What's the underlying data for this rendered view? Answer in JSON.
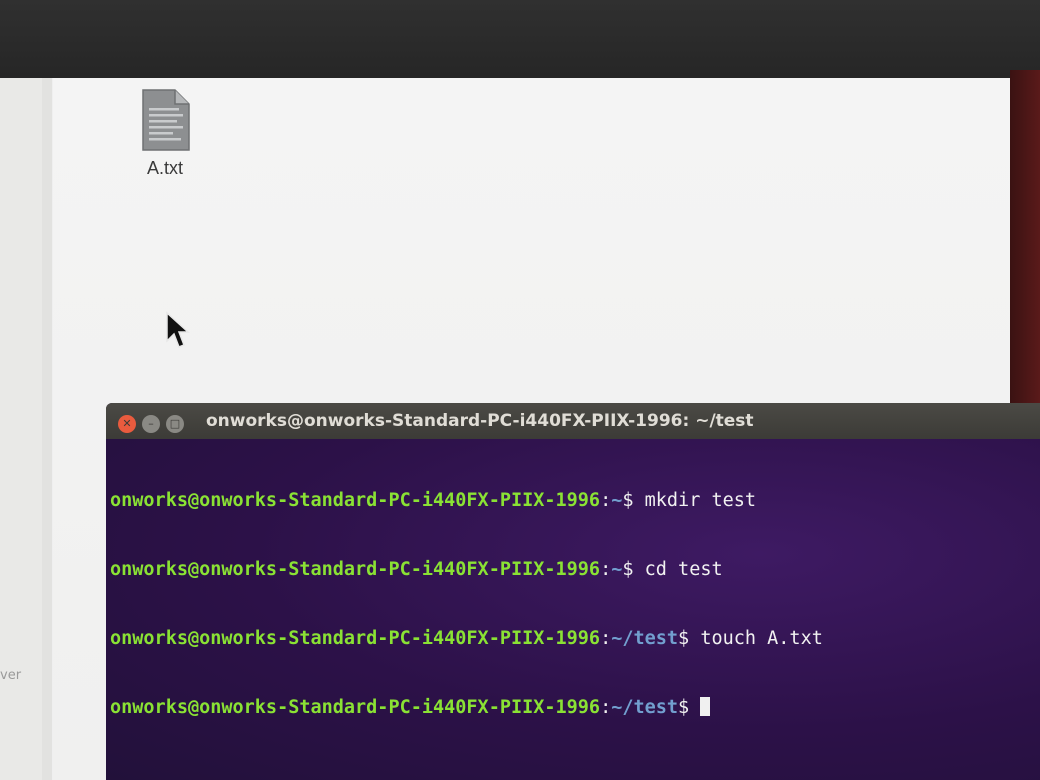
{
  "file_manager": {
    "files": [
      {
        "name": "A.txt",
        "icon": "text-file-icon"
      }
    ],
    "sidebar_partial_text": "ver"
  },
  "terminal": {
    "title": "onworks@onworks-Standard-PC-i440FX-PIIX-1996: ~/test",
    "lines": [
      {
        "user": "onworks@onworks-Standard-PC-i440FX-PIIX-1996",
        "sep": ":",
        "path": "~",
        "suffix": "$ ",
        "command": "mkdir test"
      },
      {
        "user": "onworks@onworks-Standard-PC-i440FX-PIIX-1996",
        "sep": ":",
        "path": "~",
        "suffix": "$ ",
        "command": "cd test"
      },
      {
        "user": "onworks@onworks-Standard-PC-i440FX-PIIX-1996",
        "sep": ":",
        "path": "~/test",
        "suffix": "$ ",
        "command": "touch A.txt"
      },
      {
        "user": "onworks@onworks-Standard-PC-i440FX-PIIX-1996",
        "sep": ":",
        "path": "~/test",
        "suffix": "$ ",
        "command": ""
      }
    ],
    "window_buttons": [
      "close-icon",
      "minimize-icon",
      "maximize-icon"
    ]
  },
  "colors": {
    "terminal_bg": "#2c1148",
    "prompt_user": "#8ae234",
    "prompt_path": "#729fcf",
    "close_button": "#e95b3e"
  }
}
